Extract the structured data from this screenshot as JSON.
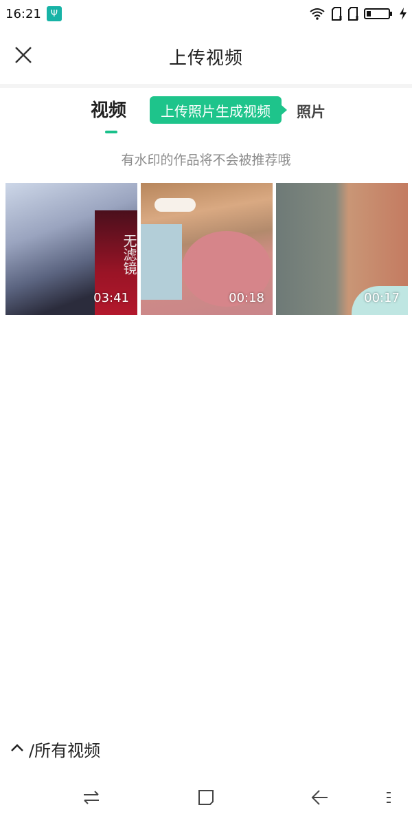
{
  "status_bar": {
    "time": "16:21",
    "usb_icon": "usb-icon",
    "icons": [
      "wifi-icon",
      "sim-card-icon",
      "sim-card-icon",
      "battery-icon",
      "charging-bolt-icon"
    ]
  },
  "header": {
    "title": "上传视频",
    "close_icon": "close-icon"
  },
  "tabs": {
    "video_label": "视频",
    "tooltip_label": "上传照片生成视频",
    "photo_label": "照片"
  },
  "notice": "有水印的作品将不会被推荐哦",
  "videos": [
    {
      "duration": "03:41",
      "overlay_text": "无滤镜"
    },
    {
      "duration": "00:18"
    },
    {
      "duration": "00:17"
    }
  ],
  "album": {
    "icon": "chevron-up-icon",
    "label": "/所有视频"
  },
  "nav_bar": {
    "icons": [
      "switch-icon",
      "home-square-icon",
      "back-arrow-icon",
      "menu-icon"
    ]
  },
  "colors": {
    "accent": "#1ec48b",
    "indicator": "#19c08a",
    "notice_text": "#8c8c8c",
    "usb_badge": "#17b3a6"
  }
}
